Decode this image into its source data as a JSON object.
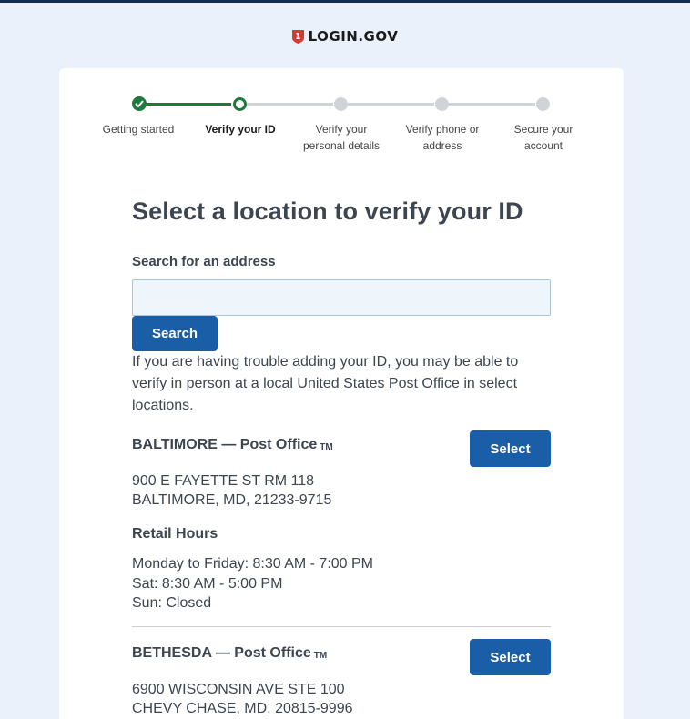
{
  "header": {
    "logo_text": "LOGIN.GOV"
  },
  "steps": [
    {
      "label": "Getting started",
      "status": "complete"
    },
    {
      "label": "Verify your ID",
      "status": "current"
    },
    {
      "label": "Verify your personal details",
      "status": "todo"
    },
    {
      "label": "Verify phone or address",
      "status": "todo"
    },
    {
      "label": "Secure your account",
      "status": "todo"
    }
  ],
  "page": {
    "title": "Select a location to verify your ID",
    "search_label": "Search for an address",
    "search_value": "",
    "search_button": "Search",
    "help_text": "If you are having trouble adding your ID, you may be able to verify in person at a local United States Post Office in select locations."
  },
  "locations": [
    {
      "name": "BALTIMORE — Post Office",
      "tm": "TM",
      "select_label": "Select",
      "address_line1": "900 E FAYETTE ST RM 118",
      "address_line2": "BALTIMORE, MD, 21233-9715",
      "hours_title": "Retail Hours",
      "hours": [
        "Monday to Friday: 8:30 AM - 7:00 PM",
        "Sat: 8:30 AM - 5:00 PM",
        "Sun: Closed"
      ]
    },
    {
      "name": "BETHESDA — Post Office",
      "tm": "TM",
      "select_label": "Select",
      "address_line1": "6900 WISCONSIN AVE STE 100",
      "address_line2": "CHEVY CHASE, MD, 20815-9996"
    }
  ],
  "colors": {
    "primary": "#1a5ea8",
    "success": "#1e7a3c",
    "background": "#eaf1fa",
    "header_bar": "#112e51"
  }
}
